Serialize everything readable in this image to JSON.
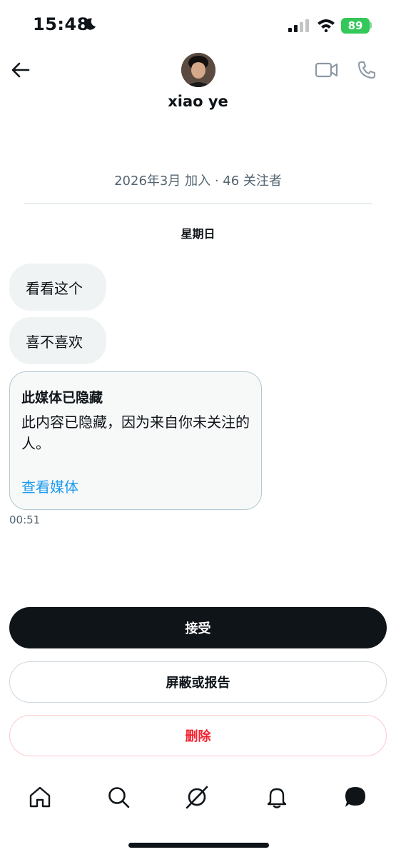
{
  "status_bar": {
    "time": "15:48",
    "battery": "89"
  },
  "header": {
    "name": "xiao ye"
  },
  "profile_info": {
    "joined": "2026年3月 加入 · 46 关注者"
  },
  "conversation": {
    "day_label": "星期日",
    "messages": [
      "看看这个",
      "喜不喜欢"
    ],
    "hidden_media": {
      "title": "此媒体已隐藏",
      "description": "此内容已隐藏，因为来自你未关注的人。",
      "link": "查看媒体"
    },
    "timestamp": "00:51"
  },
  "actions": {
    "accept": "接受",
    "block_report": "屏蔽或报告",
    "delete": "删除"
  },
  "nav": {
    "icons": [
      "home-icon",
      "search-icon",
      "grok-icon",
      "notifications-icon",
      "messages-icon"
    ]
  },
  "colors": {
    "accent": "#1d9bf0",
    "danger": "#f4212e",
    "battery": "#34c759",
    "dark": "#0f1419"
  }
}
